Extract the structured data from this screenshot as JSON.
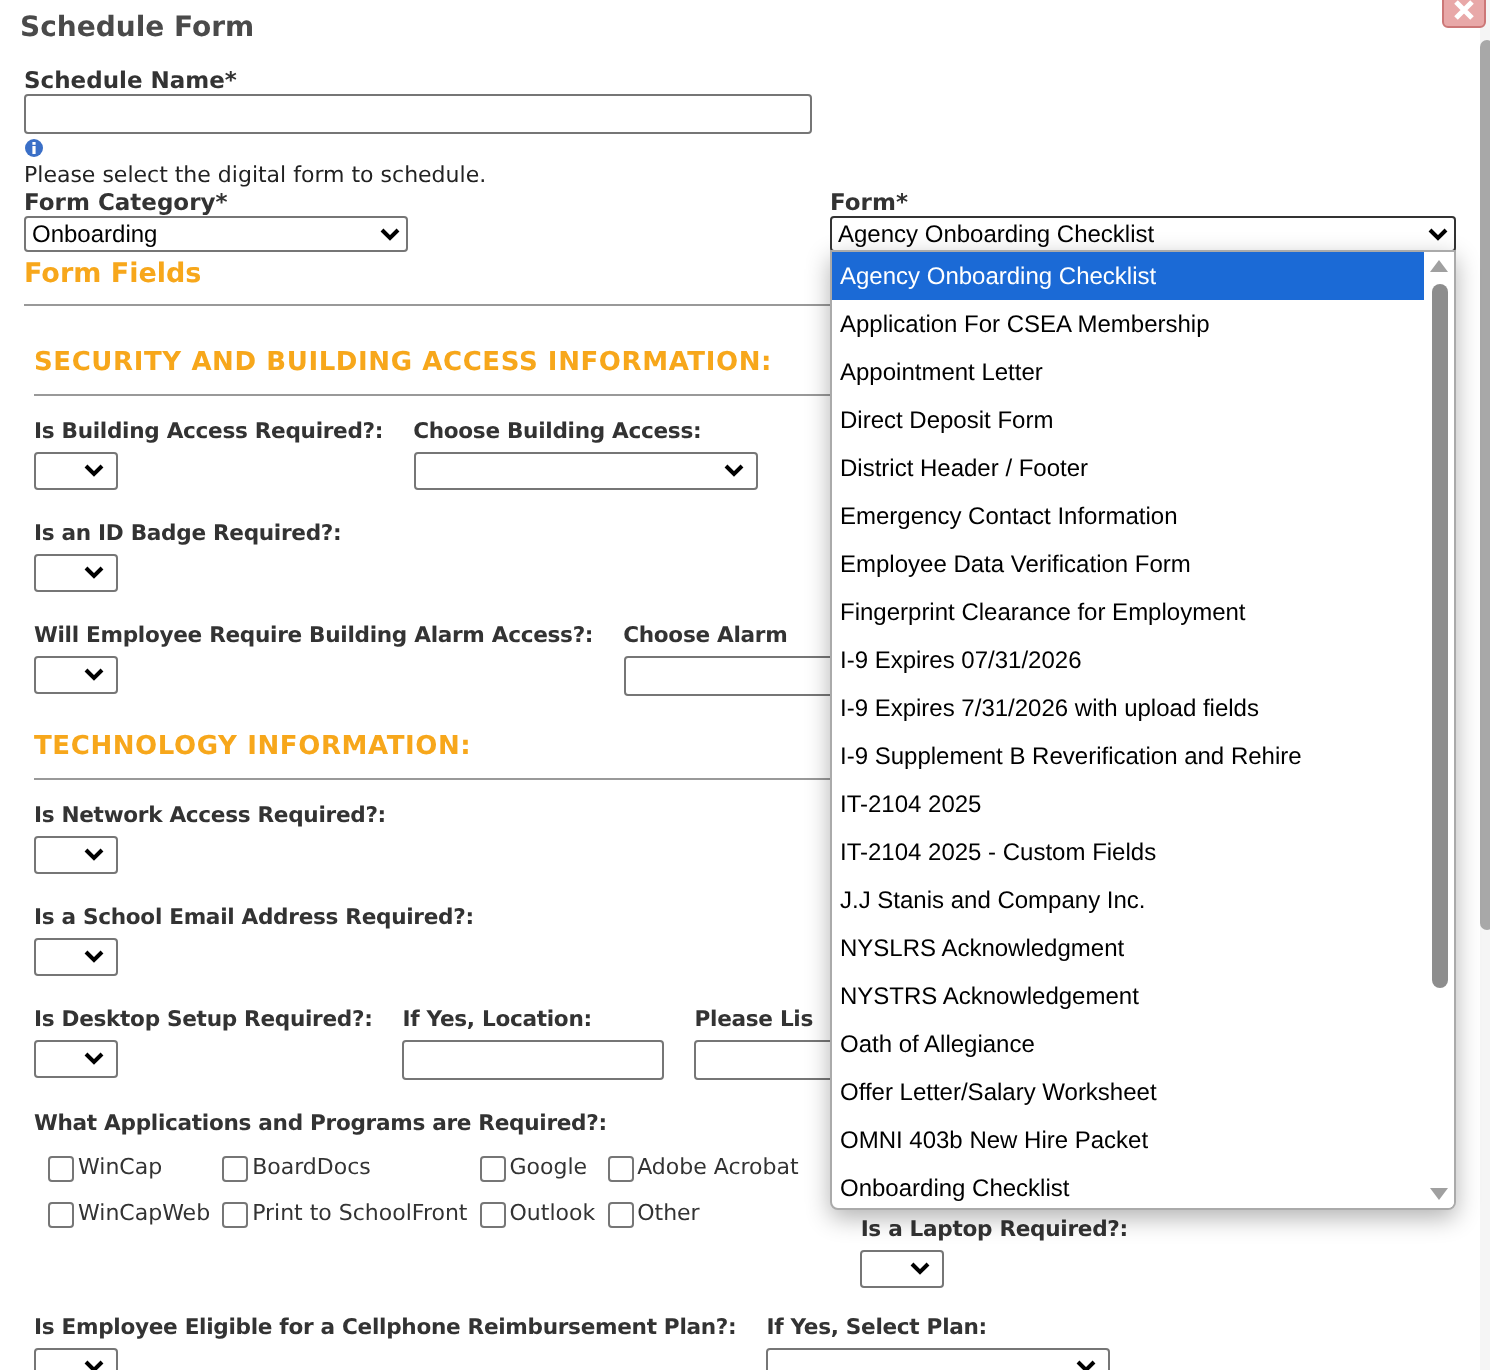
{
  "dialog": {
    "title": "Schedule Form"
  },
  "schedule_name": {
    "label": "Schedule Name*"
  },
  "hint": "Please select the digital form to schedule.",
  "form_category": {
    "label": "Form Category*",
    "value": "Onboarding"
  },
  "form": {
    "label": "Form*",
    "value": "Agency Onboarding Checklist",
    "expanded": true,
    "options": [
      {
        "label": "Agency Onboarding Checklist",
        "selected": true
      },
      {
        "label": "Application For CSEA Membership",
        "selected": false
      },
      {
        "label": "Appointment Letter",
        "selected": false
      },
      {
        "label": "Direct Deposit Form",
        "selected": false
      },
      {
        "label": "District Header / Footer",
        "selected": false
      },
      {
        "label": "Emergency Contact Information",
        "selected": false
      },
      {
        "label": "Employee Data Verification Form",
        "selected": false
      },
      {
        "label": "Fingerprint Clearance for Employment",
        "selected": false
      },
      {
        "label": "I-9 Expires 07/31/2026",
        "selected": false
      },
      {
        "label": "I-9 Expires 7/31/2026 with upload fields",
        "selected": false
      },
      {
        "label": "I-9 Supplement B Reverification and Rehire",
        "selected": false
      },
      {
        "label": "IT-2104 2025",
        "selected": false
      },
      {
        "label": "IT-2104 2025 - Custom Fields",
        "selected": false
      },
      {
        "label": "J.J Stanis and Company Inc.",
        "selected": false
      },
      {
        "label": "NYSLRS Acknowledgment",
        "selected": false
      },
      {
        "label": "NYSTRS Acknowledgement",
        "selected": false
      },
      {
        "label": "Oath of Allegiance",
        "selected": false
      },
      {
        "label": "Offer Letter/Salary Worksheet",
        "selected": false
      },
      {
        "label": "OMNI 403b New Hire Packet",
        "selected": false
      },
      {
        "label": "Onboarding Checklist",
        "selected": false
      }
    ]
  },
  "form_fields_title": "Form Fields",
  "sections": [
    {
      "heading": "SECURITY AND BUILDING ACCESS INFORMATION:",
      "rows": [
        {
          "kind": "fields",
          "fields": [
            {
              "kind": "yes_no",
              "label": "Is Building Access Required?:"
            },
            {
              "kind": "select",
              "label": "Choose Building Access:"
            }
          ]
        },
        {
          "kind": "fields",
          "fields": [
            {
              "kind": "yes_no",
              "label": "Is an ID Badge Required?:"
            }
          ]
        },
        {
          "kind": "fields",
          "fields": [
            {
              "kind": "yes_no",
              "label": "Will Employee Require Building Alarm Access?:"
            },
            {
              "kind": "text",
              "label": "Choose Alarm"
            }
          ]
        }
      ]
    },
    {
      "heading": "TECHNOLOGY INFORMATION:",
      "rows": [
        {
          "kind": "fields",
          "fields": [
            {
              "kind": "yes_no",
              "label": "Is Network Access Required?:"
            }
          ]
        },
        {
          "kind": "fields",
          "fields": [
            {
              "kind": "yes_no",
              "label": "Is a School Email Address Required?:"
            }
          ]
        },
        {
          "kind": "fields",
          "fields": [
            {
              "kind": "yes_no",
              "label": "Is Desktop Setup Required?:"
            },
            {
              "kind": "text",
              "label": "If Yes, Location:"
            },
            {
              "kind": "text",
              "label": "Please Lis"
            }
          ]
        },
        {
          "kind": "checklist",
          "label": "What Applications and Programs are Required?:",
          "options": [
            {
              "label": "WinCap",
              "checked": false
            },
            {
              "label": "BoardDocs",
              "checked": false
            },
            {
              "label": "Google",
              "checked": false
            },
            {
              "label": "Adobe Acrobat",
              "checked": false
            },
            {
              "label": "WinCapWeb",
              "checked": false
            },
            {
              "label": "Print to SchoolFront",
              "checked": false
            },
            {
              "label": "Outlook",
              "checked": false
            },
            {
              "label": "Other",
              "checked": false
            }
          ],
          "side_field": {
            "kind": "yes_no",
            "label": "Is a Laptop Required?:"
          }
        },
        {
          "kind": "fields",
          "fields": [
            {
              "kind": "yes_no",
              "label": "Is Employee Eligible for a Cellphone Reimbursement Plan?:"
            },
            {
              "kind": "select",
              "label": "If Yes, Select Plan:"
            }
          ]
        }
      ]
    }
  ]
}
